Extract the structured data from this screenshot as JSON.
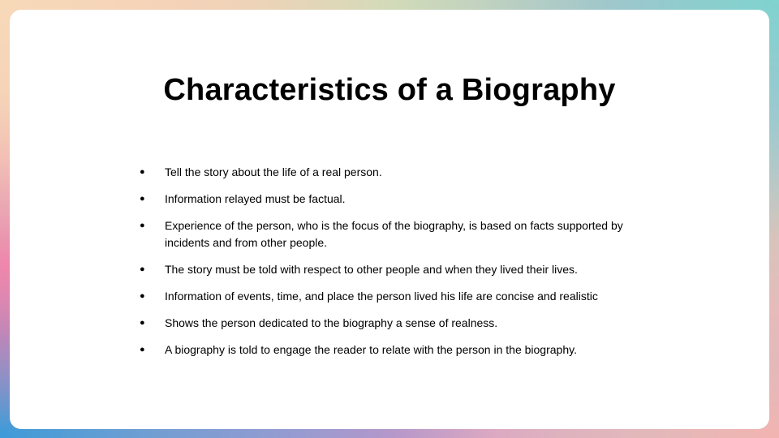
{
  "slide": {
    "title": "Characteristics of a Biography",
    "bullet_symbol": "●",
    "bullets": [
      "Tell the story about the life of a real person.",
      "Information relayed must be factual.",
      "Experience of the person, who is the focus of the biography, is based on facts supported by incidents and from other people.",
      "The story must be told with respect to other people and when they lived their lives.",
      "Information of events, time, and place the person lived his life are concise and realistic",
      "Shows the person dedicated to the biography a sense of realness.",
      "A biography is told to engage the reader to relate with the person in the biography."
    ]
  }
}
